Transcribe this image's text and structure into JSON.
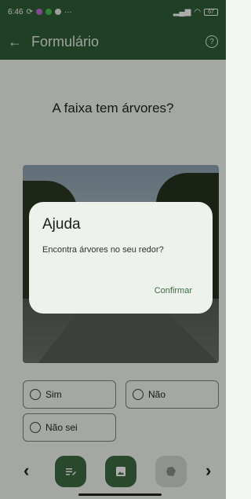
{
  "status_bar": {
    "time": "6:46",
    "overflow": "···",
    "battery": "67",
    "icons": [
      "sync-icon",
      "app-icon",
      "messages-icon",
      "media-icon",
      "signal-icon",
      "wifi-icon",
      "battery-icon"
    ]
  },
  "app_bar": {
    "back_icon": "←",
    "title": "Formulário",
    "help_icon": "?"
  },
  "question": "A faixa tem árvores?",
  "options": [
    {
      "label": "Sim"
    },
    {
      "label": "Não"
    },
    {
      "label": "Não sei"
    }
  ],
  "bottom_nav": {
    "prev_icon": "‹",
    "next_icon": "›"
  },
  "dialog": {
    "title": "Ajuda",
    "text": "Encontra árvores no seu redor?",
    "confirm": "Confirmar"
  },
  "colors": {
    "primary": "#2f5f36",
    "accent": "#3d6b42",
    "background": "#f3f6f1",
    "dialog": "#eef2ec"
  }
}
